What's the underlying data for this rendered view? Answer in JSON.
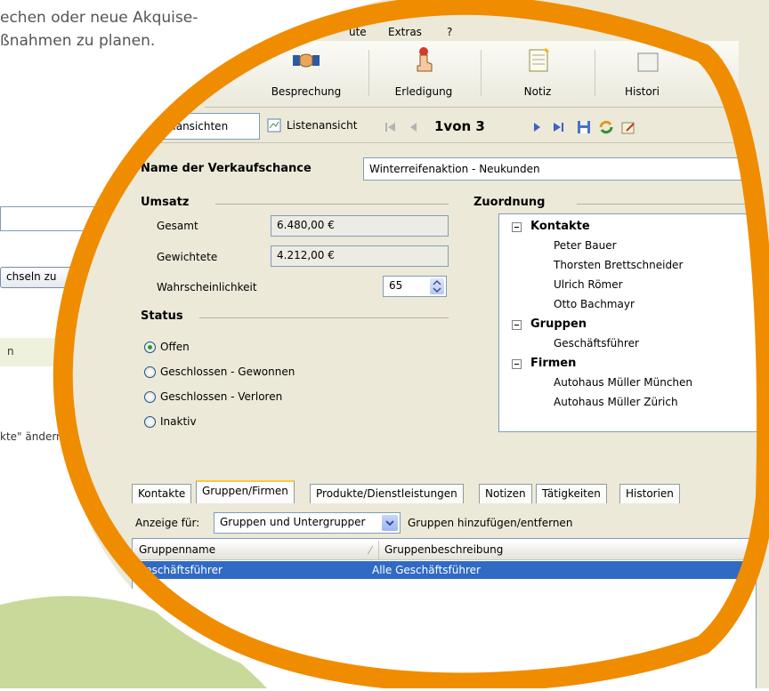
{
  "background": {
    "intro_line1": "echen oder neue Akquise-",
    "intro_line2": "ßnahmen zu planen.",
    "switch_button": "chseln zu",
    "group_label_fragment": "n",
    "change_text": "kte\" ändern"
  },
  "menu": {
    "items": [
      "ute",
      "Extras",
      "?"
    ]
  },
  "toolbar": {
    "buttons": [
      {
        "label": "Besprechung",
        "icon": "handshake-icon"
      },
      {
        "label": "Erledigung",
        "icon": "pointing-hand-icon"
      },
      {
        "label": "Notiz",
        "icon": "notepad-icon"
      },
      {
        "label": "Histori",
        "icon": "history-icon"
      }
    ]
  },
  "nav": {
    "detail_tab": "tailansichten",
    "list_tab": "Listenansicht",
    "record_position": "1von 3"
  },
  "form": {
    "name_label": "Name der Verkaufschance",
    "name_value": "Winterreifenaktion - Neukunden",
    "umsatz_heading": "Umsatz",
    "gesamt_label": "Gesamt",
    "gesamt_value": "6.480,00 €",
    "gewichtete_label": "Gewichtete",
    "gewichtete_value": "4.212,00 €",
    "probability_label": "Wahrscheinlichkeit",
    "probability_value": "65",
    "status_heading": "Status",
    "status_options": [
      {
        "label": "Offen",
        "selected": true
      },
      {
        "label": "Geschlossen - Gewonnen",
        "selected": false
      },
      {
        "label": "Geschlossen - Verloren",
        "selected": false
      },
      {
        "label": "Inaktiv",
        "selected": false
      }
    ],
    "zuordnung_heading": "Zuordnung"
  },
  "tree": {
    "groups": [
      {
        "label": "Kontakte",
        "children": [
          "Peter Bauer",
          "Thorsten Brettschneider",
          "Ulrich Römer",
          "Otto Bachmayr"
        ]
      },
      {
        "label": "Gruppen",
        "children": [
          "Geschäftsführer"
        ]
      },
      {
        "label": "Firmen",
        "children": [
          "Autohaus Müller München",
          "Autohaus Müller Zürich"
        ]
      }
    ]
  },
  "tabs": [
    {
      "label": "Kontakte",
      "active": false
    },
    {
      "label": "Gruppen/Firmen",
      "active": true
    },
    {
      "label": "Produkte/Dienstleistungen",
      "active": false
    },
    {
      "label": "Notizen",
      "active": false
    },
    {
      "label": "Tätigkeiten",
      "active": false
    },
    {
      "label": "Historien",
      "active": false
    }
  ],
  "lower": {
    "anzeige_label": "Anzeige für:",
    "anzeige_value": "Gruppen und Untergrupper",
    "add_remove_label": "Gruppen hinzufügen/entfernen",
    "col_name": "Gruppenname",
    "col_desc": "Gruppenbeschreibung",
    "row_name": "Geschäftsführer",
    "row_desc": "Alle Geschäftsführer"
  },
  "colors": {
    "ring": "#f08c00",
    "green_light": "#dbe6b5",
    "green_mid": "#c9d99a",
    "selection": "#316ac5",
    "window_bg": "#ece9d8"
  }
}
